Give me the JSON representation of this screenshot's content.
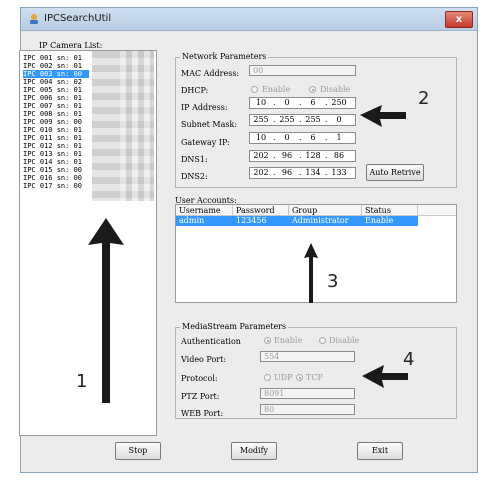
{
  "window": {
    "title": "IPCSearchUtil",
    "close_label": "x"
  },
  "camera_list": {
    "label": "IP Camera List:",
    "items": [
      "IPC 001 sn: 01",
      "IPC 002 sn: 01",
      "IPC 003 sn: 00",
      "IPC 004 sn: 02",
      "IPC 005 sn: 01",
      "IPC 006 sn: 01",
      "IPC 007 sn: 01",
      "IPC 008 sn: 01",
      "IPC 009 sn: 00",
      "IPC 010 sn: 01",
      "IPC 011 sn: 01",
      "IPC 012 sn: 01",
      "IPC 013 sn: 01",
      "IPC 014 sn: 01",
      "IPC 015 sn: 00",
      "IPC 016 sn: 00",
      "IPC 017 sn: 00"
    ],
    "selected_index": 2
  },
  "network": {
    "title": "Network Parameters",
    "mac_label": "MAC Address:",
    "mac_value": "00",
    "dhcp_label": "DHCP:",
    "dhcp_enable": "Enable",
    "dhcp_disable": "Disable",
    "ip_label": "IP Address:",
    "ip": [
      "10",
      "0",
      "6",
      "250"
    ],
    "mask_label": "Subnet Mask:",
    "mask": [
      "255",
      "255",
      "255",
      "0"
    ],
    "gateway_label": "Gateway IP:",
    "gateway": [
      "10",
      "0",
      "6",
      "1"
    ],
    "dns1_label": "DNS1:",
    "dns1": [
      "202",
      "96",
      "128",
      "86"
    ],
    "dns2_label": "DNS2:",
    "dns2": [
      "202",
      "96",
      "134",
      "133"
    ],
    "auto_retrive": "Auto Retrive"
  },
  "users": {
    "label": "User Accounts:",
    "columns": [
      "Username",
      "Password",
      "Group",
      "Status"
    ],
    "rows": [
      [
        "admin",
        "123456",
        "Administrator",
        "Enable"
      ]
    ]
  },
  "media": {
    "title": "MediaStream Parameters",
    "auth_label": "Authentication",
    "auth_enable": "Enable",
    "auth_disable": "Disable",
    "video_port_label": "Video Port:",
    "video_port": "554",
    "protocol_label": "Protocol:",
    "protocol_udp": "UDP",
    "protocol_tcp": "TCP",
    "ptz_port_label": "PTZ Port:",
    "ptz_port": "8091",
    "web_port_label": "WEB Port:",
    "web_port": "80"
  },
  "buttons": {
    "stop": "Stop",
    "modify": "Modify",
    "exit": "Exit"
  },
  "annotations": [
    "1",
    "2",
    "3",
    "4"
  ],
  "colors": {
    "selection": "#3399ff",
    "close": "#c0392b"
  }
}
